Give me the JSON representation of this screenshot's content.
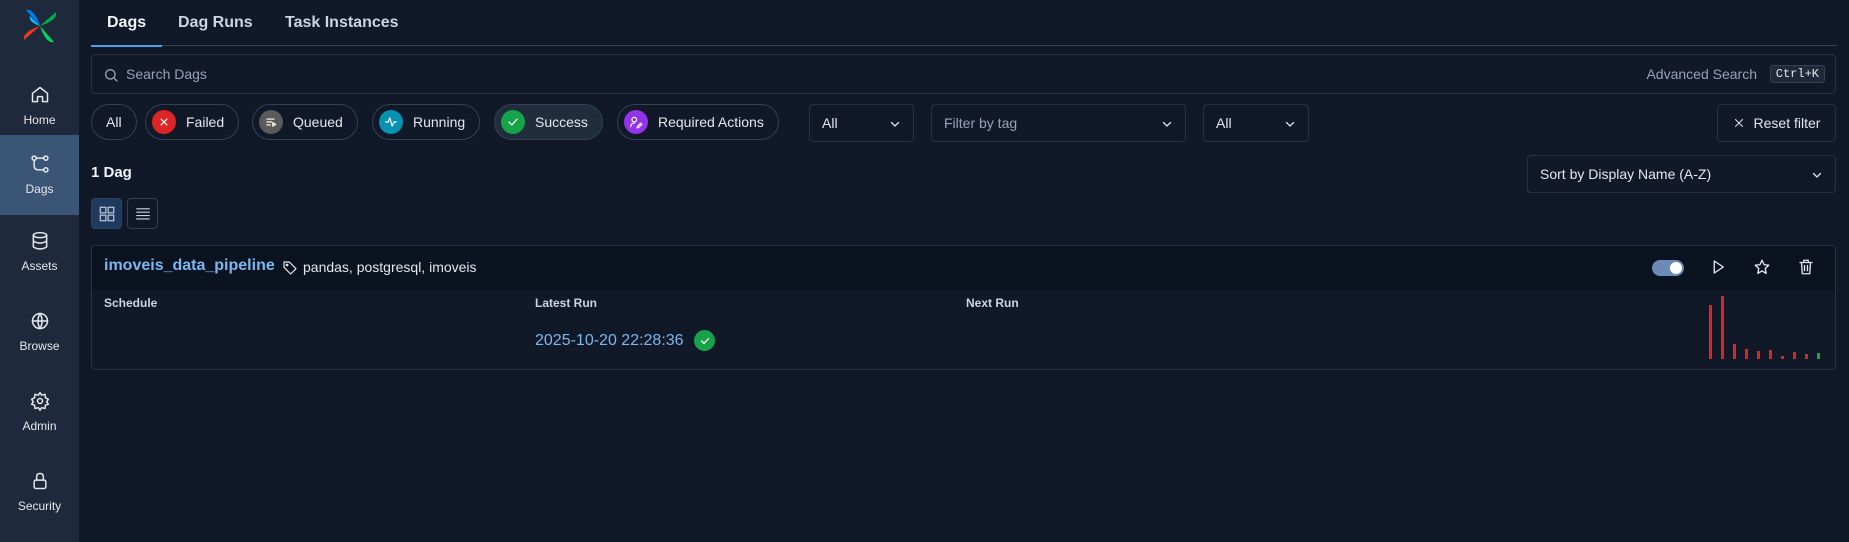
{
  "sidebar": {
    "items": [
      {
        "label": "Home",
        "icon": "home-icon"
      },
      {
        "label": "Dags",
        "icon": "dags-icon",
        "active": true
      },
      {
        "label": "Assets",
        "icon": "database-icon"
      },
      {
        "label": "Browse",
        "icon": "globe-icon"
      },
      {
        "label": "Admin",
        "icon": "gear-icon"
      },
      {
        "label": "Security",
        "icon": "lock-icon"
      }
    ]
  },
  "tabs": [
    {
      "label": "Dags",
      "active": true
    },
    {
      "label": "Dag Runs"
    },
    {
      "label": "Task Instances"
    }
  ],
  "search": {
    "placeholder": "Search Dags",
    "value": "",
    "advanced_label": "Advanced Search",
    "shortcut": "Ctrl+K"
  },
  "filters": {
    "state_pills": [
      {
        "label": "All"
      },
      {
        "label": "Failed",
        "color": "#dc2626",
        "icon": "x-icon"
      },
      {
        "label": "Queued",
        "color": "#6b6b6b",
        "icon": "queue-icon"
      },
      {
        "label": "Running",
        "color": "#0891b2",
        "icon": "activity-icon"
      },
      {
        "label": "Success",
        "color": "#16a34a",
        "icon": "check-icon",
        "selected": true
      },
      {
        "label": "Required Actions",
        "color": "#9333ea",
        "icon": "user-pen-icon"
      }
    ],
    "paused_select": "All",
    "tag_placeholder": "Filter by tag",
    "owner_select": "All",
    "reset_label": "Reset filter"
  },
  "results": {
    "count_label": "1 Dag",
    "sort_label": "Sort by Display Name (A-Z)"
  },
  "dag": {
    "name": "imoveis_data_pipeline",
    "tags": "pandas, postgresql, imoveis",
    "enabled": true,
    "columns": {
      "schedule": "Schedule",
      "latest_run": "Latest Run",
      "next_run": "Next Run"
    },
    "latest_run_date": "2025-10-20 22:28:36",
    "latest_run_state": "success",
    "recent_runs": [
      {
        "duration": 0.86,
        "state": "failed"
      },
      {
        "duration": 1.0,
        "state": "failed"
      },
      {
        "duration": 0.24,
        "state": "failed"
      },
      {
        "duration": 0.16,
        "state": "failed"
      },
      {
        "duration": 0.13,
        "state": "failed"
      },
      {
        "duration": 0.14,
        "state": "failed"
      },
      {
        "duration": 0.05,
        "state": "failed"
      },
      {
        "duration": 0.11,
        "state": "failed"
      },
      {
        "duration": 0.08,
        "state": "failed"
      },
      {
        "duration": 0.1,
        "state": "success"
      }
    ],
    "state_colors": {
      "failed": "#dc2626",
      "success": "#16a34a"
    }
  }
}
